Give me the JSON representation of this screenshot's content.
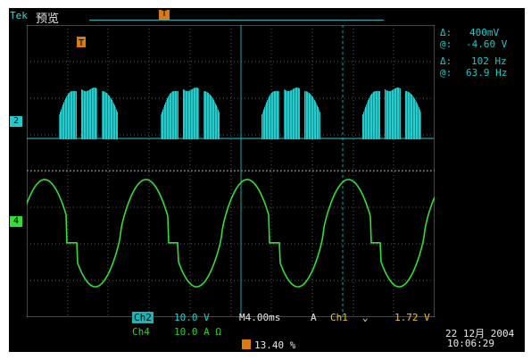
{
  "header": {
    "brand": "Tek",
    "mode": "预览"
  },
  "measurements": [
    {
      "symbol": "Δ:",
      "value": "400mV"
    },
    {
      "symbol": "@:",
      "value": "-4.60 V"
    },
    {
      "symbol": "Δ:",
      "value": "102 Hz"
    },
    {
      "symbol": "@:",
      "value": "63.9 Hz"
    }
  ],
  "channels": {
    "ch2": {
      "label": "Ch2",
      "scale": "10.0 V",
      "marker": "2",
      "color": "#22cccc"
    },
    "ch4": {
      "label": "Ch4",
      "scale": "10.0 A Ω",
      "marker": "4",
      "color": "#33dd33"
    }
  },
  "timebase": "M4.00ms",
  "trigger": {
    "mode": "A",
    "source": "Ch1",
    "slope": "⌄",
    "level": "1.72 V",
    "position": "13.40 %"
  },
  "datetime": {
    "date": "22 12月 2004",
    "time": "10:06:29"
  }
}
